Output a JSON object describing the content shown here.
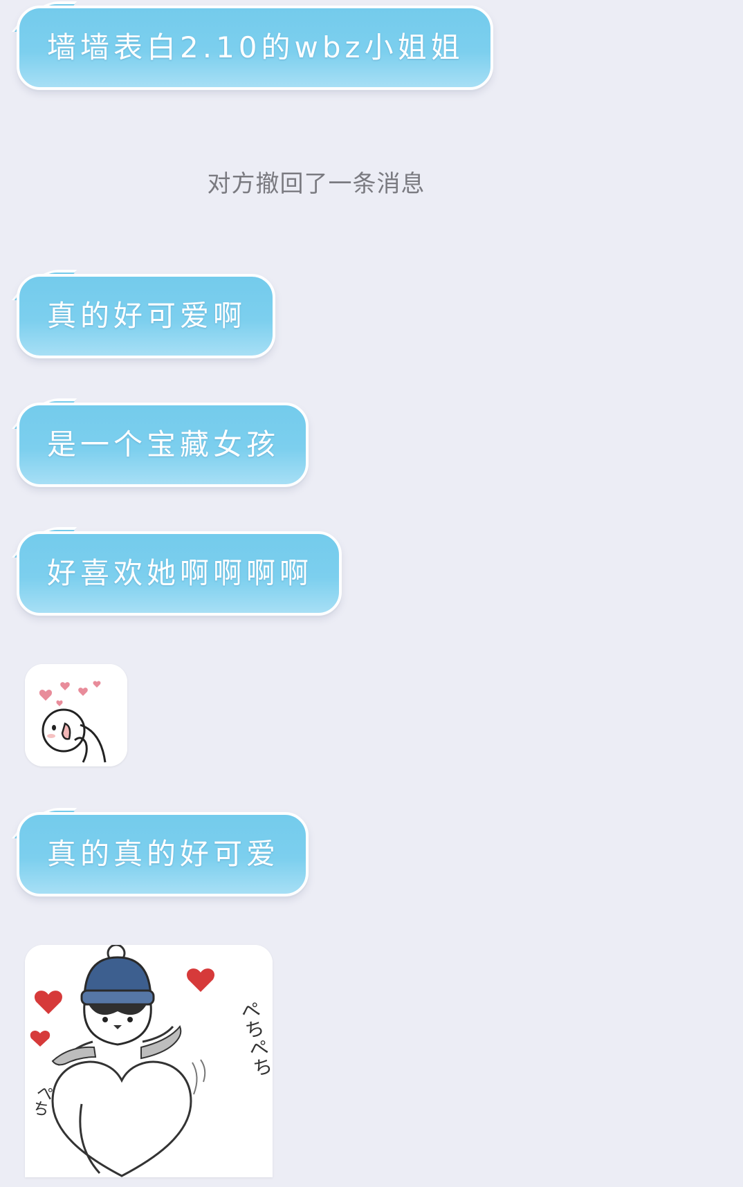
{
  "messages": [
    {
      "text": "墙墙表白2.10的wbz小姐姐"
    },
    {
      "text": "真的好可爱啊"
    },
    {
      "text": "是一个宝藏女孩"
    },
    {
      "text": "好喜欢她啊啊啊啊"
    },
    {
      "text": "真的真的好可爱"
    }
  ],
  "system_notice": "对方撤回了一条消息",
  "stickers": [
    {
      "icon": "blushing-face-hearts-sticker"
    },
    {
      "icon": "penguin-heart-sticker",
      "caption_1": "ぺちぺち",
      "caption_2": "ぺち"
    }
  ],
  "colors": {
    "bubble": "#7ccfee",
    "background": "#ecedf5",
    "notice_text": "#7a7a80"
  }
}
